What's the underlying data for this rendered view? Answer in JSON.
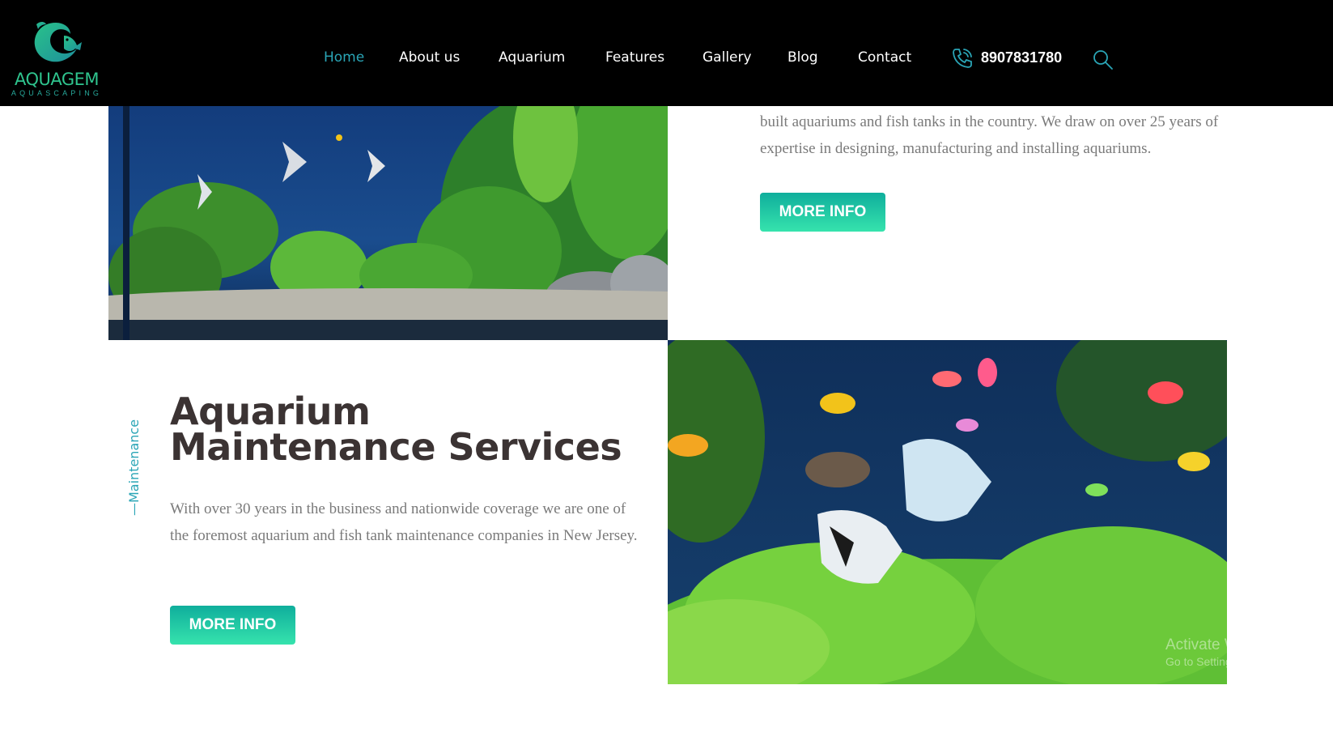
{
  "brand": {
    "name": "AQUAGEM",
    "tagline": "AQUASCAPING",
    "logo_icon": "fish-logo-icon",
    "colors": {
      "green": "#2fc48e",
      "teal": "#2aa5b6"
    }
  },
  "nav": {
    "items": [
      {
        "label": "Home",
        "active": true
      },
      {
        "label": "About us"
      },
      {
        "label": "Aquarium"
      },
      {
        "label": "Features"
      },
      {
        "label": "Gallery"
      },
      {
        "label": "Blog"
      },
      {
        "label": "Contact"
      }
    ],
    "phone": "8907831780",
    "phone_icon": "phone-icon",
    "search_icon": "search-icon"
  },
  "intro": {
    "text": "built aquariums and fish tanks in the country. We draw on over 25 years of expertise in designing, manufacturing and installing aquariums.",
    "button": "MORE INFO"
  },
  "maintenance": {
    "side_label": "Maintenance",
    "title_line1": "Aquarium",
    "title_line2": "Maintenance Services",
    "text": "With over 30 years in the business and nationwide coverage we are one of the foremost aquarium and fish tank maintenance companies in New Jersey.",
    "button": "MORE INFO"
  },
  "watermark": {
    "line1": "Activate Windo",
    "line2": "Go to Settings to ac"
  },
  "buttons_color": {
    "start": "#0fae9c",
    "end": "#36e3ad"
  }
}
